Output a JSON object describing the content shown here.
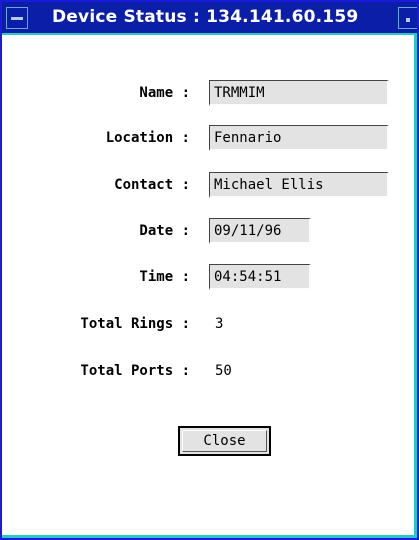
{
  "window": {
    "title": "Device Status : 134.141.60.159"
  },
  "fields": [
    {
      "label": "Name :",
      "value": "TRMMIM"
    },
    {
      "label": "Location :",
      "value": "Fennario"
    },
    {
      "label": "Contact :",
      "value": "Michael Ellis"
    },
    {
      "label": "Date :",
      "value": "09/11/96"
    },
    {
      "label": "Time :",
      "value": "04:54:51"
    }
  ],
  "stats": [
    {
      "label": "Total Rings :",
      "value": "3"
    },
    {
      "label": "Total Ports :",
      "value": "50"
    }
  ],
  "buttons": {
    "close_label": "Close"
  },
  "colors": {
    "titlebar": "#0a1ea8",
    "border": "#1a1ad8",
    "accent": "#29c7c7",
    "field_bg": "#e3e3e3"
  }
}
